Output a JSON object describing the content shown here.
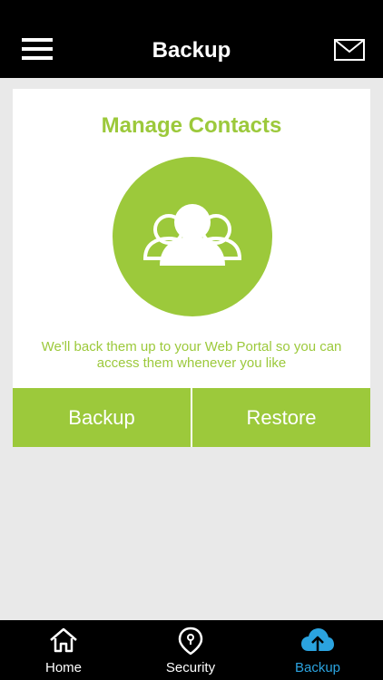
{
  "header": {
    "title": "Backup",
    "menu_icon": "hamburger-menu-icon",
    "mail_icon": "mail-icon"
  },
  "card": {
    "title": "Manage Contacts",
    "icon": "contacts-group-icon",
    "description": "We'll back them up to your Web Portal so you can access them whenever you like",
    "buttons": {
      "backup": "Backup",
      "restore": "Restore"
    }
  },
  "tabbar": {
    "items": [
      {
        "label": "Home",
        "icon": "home-icon",
        "active": false
      },
      {
        "label": "Security",
        "icon": "security-pin-icon",
        "active": false
      },
      {
        "label": "Backup",
        "icon": "cloud-upload-icon",
        "active": true
      }
    ]
  },
  "colors": {
    "accent_green": "#9cc93b",
    "active_tab_blue": "#2ba3df",
    "header_black": "#000000",
    "page_background": "#e9e9e9"
  }
}
